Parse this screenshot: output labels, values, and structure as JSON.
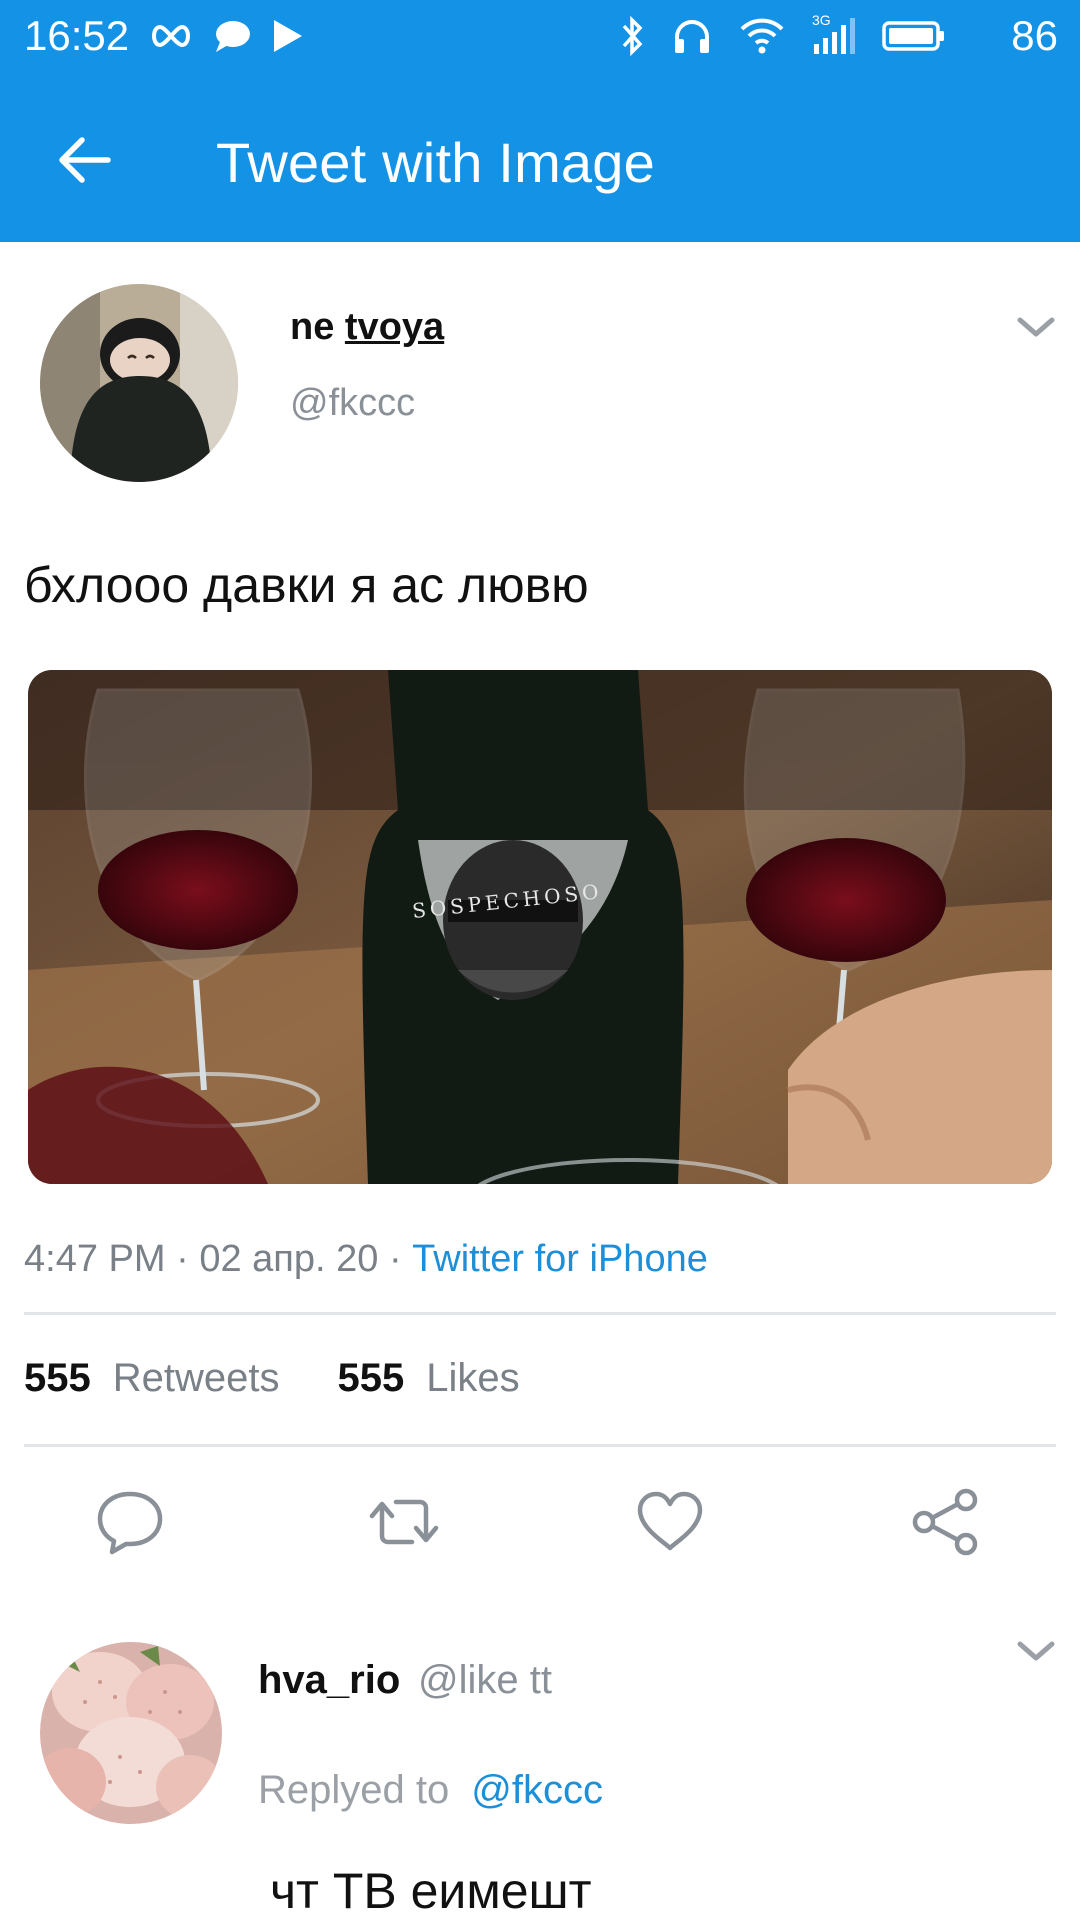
{
  "status_bar": {
    "time": "16:52",
    "network_label": "3G",
    "battery_percent": "86",
    "left_icons": [
      "infinity-icon",
      "chat-bubble-icon",
      "play-icon"
    ],
    "right_icons": [
      "bluetooth-icon",
      "headphones-icon",
      "wifi-icon",
      "signal-icon",
      "battery-icon"
    ]
  },
  "app_bar": {
    "title": "Tweet with Image",
    "back_icon": "arrow-left-icon"
  },
  "tweet": {
    "author_name_part1": "ne ",
    "author_name_part2": "tvoya",
    "author_handle": "@fkccc",
    "text": "бхлооо давки я ас лювю",
    "image_bottle_label": "SOSPECHOSO",
    "time": "4:47 PM",
    "date": "02 апр. 20",
    "separator": "·",
    "source": "Twitter for iPhone",
    "retweets_count": "555",
    "retweets_label": "Retweets",
    "likes_count": "555",
    "likes_label": "Likes",
    "actions": [
      "reply-icon",
      "retweet-icon",
      "like-icon",
      "share-icon"
    ]
  },
  "reply": {
    "author_name": "hva_rio",
    "author_handle": "@like tt",
    "replied_to_label": "Replyed to",
    "replied_to_handle": "@fkccc",
    "text": "чт ТВ еимешт"
  },
  "colors": {
    "accent": "#1492e6",
    "link": "#1d8fd8",
    "muted": "#7a8087",
    "divider": "#e2e5e8"
  }
}
